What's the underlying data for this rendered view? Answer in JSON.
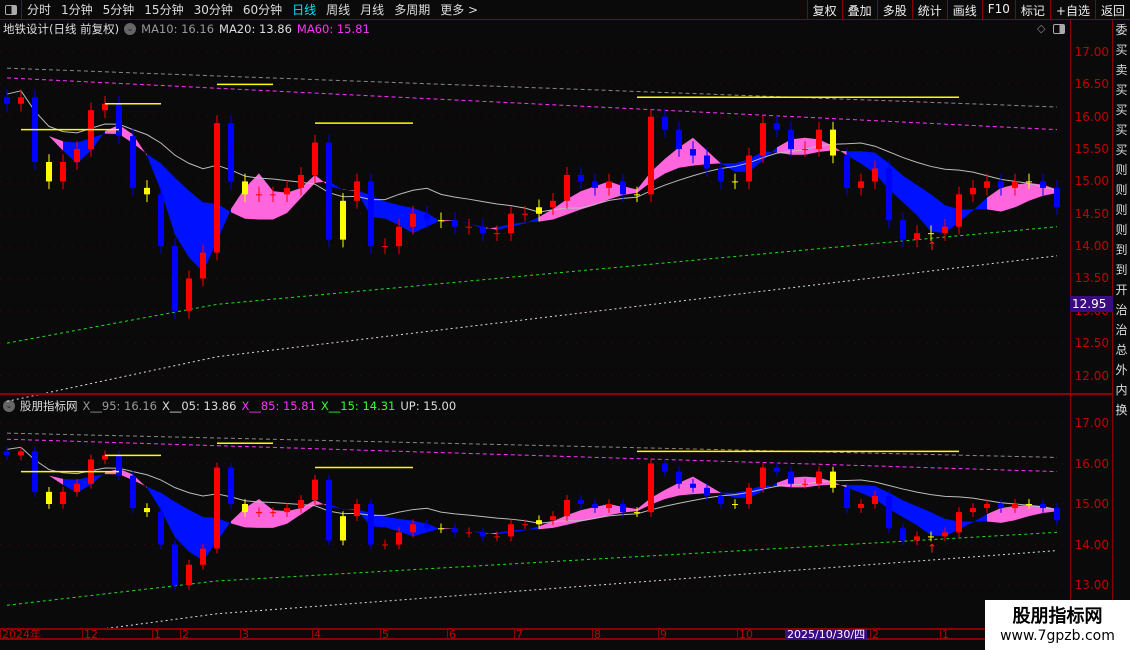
{
  "toolbar": {
    "periods": [
      "分时",
      "1分钟",
      "5分钟",
      "15分钟",
      "30分钟",
      "60分钟",
      "日线",
      "周线",
      "月线",
      "多周期",
      "更多 >"
    ],
    "active": "日线",
    "right_buttons": [
      "复权",
      "叠加",
      "多股",
      "统计",
      "画线",
      "F10",
      "标记",
      "+自选",
      "返回"
    ]
  },
  "main_pane": {
    "title": "地铁设计(日线 前复权)",
    "ma10": "MA10: 16.16",
    "ma20": "MA20: 13.86",
    "ma60": "MA60: 15.81",
    "ticks": [
      "17.00",
      "16.50",
      "16.00",
      "15.50",
      "15.00",
      "14.50",
      "14.00",
      "13.50",
      "13.00",
      "12.50",
      "12.00"
    ],
    "current_price": "12.95"
  },
  "sub_pane": {
    "title": "股朋指标网",
    "x95": "X__95: 16.16",
    "x05": "X__05: 13.86",
    "x85": "X__85: 15.81",
    "x15": "X__15: 14.31",
    "up": "UP: 15.00",
    "ticks": [
      "17.00",
      "16.00",
      "15.00",
      "14.00",
      "13.00"
    ]
  },
  "xaxis": {
    "labels": [
      "2024年",
      "12",
      "1",
      "2",
      "3",
      "4",
      "5",
      "6",
      "7",
      "8",
      "9",
      "10",
      "2",
      "1"
    ],
    "highlight_date": "2025/10/30/四"
  },
  "side_strip": "委买卖买买买买则则则则到到开治治总外内换",
  "watermark": {
    "name": "股朋指标网",
    "url": "www.7gpzb.com"
  },
  "colors": {
    "up": "#ff0000",
    "down": "#0000ff",
    "ribbon_up": "#ff66dd",
    "ribbon_down": "#0011ff",
    "accent": "#00e5ff",
    "axis": "#c00000"
  },
  "chart_data": {
    "type": "candlestick",
    "closes": [
      16.2,
      16.3,
      15.3,
      15.0,
      15.3,
      15.5,
      16.1,
      16.2,
      15.7,
      14.9,
      14.8,
      14.0,
      13.0,
      13.5,
      13.9,
      15.9,
      15.0,
      14.8,
      14.8,
      14.8,
      14.9,
      15.1,
      15.6,
      14.1,
      14.7,
      15.0,
      14.0,
      14.0,
      14.3,
      14.5,
      14.4,
      14.4,
      14.3,
      14.3,
      14.2,
      14.2,
      14.5,
      14.5,
      14.6,
      14.7,
      15.1,
      15.0,
      14.9,
      15.0,
      14.8,
      14.8,
      16.0,
      15.8,
      15.5,
      15.4,
      15.2,
      15.0,
      15.0,
      15.4,
      15.9,
      15.8,
      15.5,
      15.5,
      15.8,
      15.4,
      14.9,
      15.0,
      15.2,
      14.4,
      14.1,
      14.2,
      14.2,
      14.3,
      14.8,
      14.9,
      15.0,
      14.9,
      15.0,
      15.0,
      14.9,
      14.6
    ],
    "main_ylim": [
      11.8,
      17.2
    ],
    "sub_ylim": [
      12.8,
      17.3
    ]
  }
}
